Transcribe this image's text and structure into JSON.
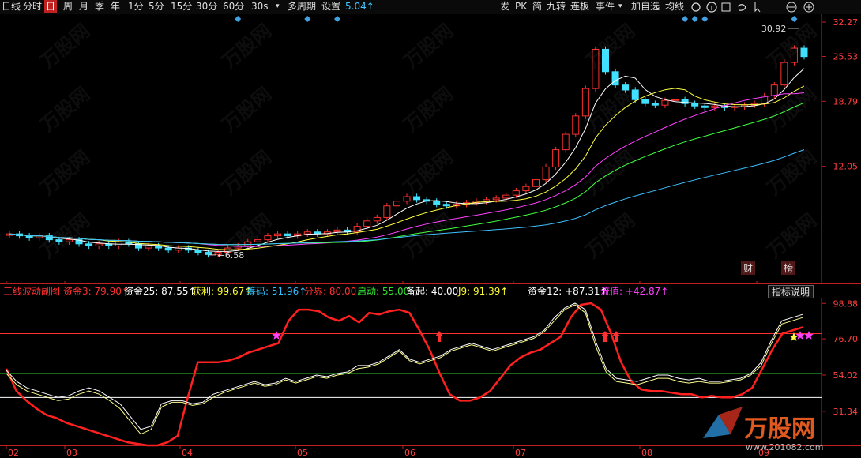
{
  "toolbar": {
    "items": [
      "日线",
      "分时",
      "日",
      "周",
      "月",
      "季",
      "年",
      "1分",
      "5分",
      "15分",
      "30分",
      "60分",
      "30s",
      "▾",
      "多周期",
      "设置"
    ],
    "active_index": 2,
    "value_label": "5.04↑",
    "right_items": [
      "发",
      "PK",
      "简",
      "九转",
      "连板",
      "事件",
      "▾",
      "加自选",
      "均线"
    ]
  },
  "indicator": {
    "name": "三线波动副图",
    "series_labels": [
      {
        "text": "资金3: 79.90↑",
        "color": "#ff3030"
      },
      {
        "text": "资金25: 87.55↑",
        "color": "#ffffff"
      },
      {
        "text": "获利: 99.67↑",
        "color": "#ffff30"
      },
      {
        "text": "筹码: 51.96↑",
        "color": "#30c0ff"
      },
      {
        "text": "分界: 80.00",
        "color": "#ff3030"
      },
      {
        "text": "启动: 55.00",
        "color": "#30e030"
      },
      {
        "text": "备起: 40.00",
        "color": "#ffffff"
      },
      {
        "text": "J9: 91.39↑",
        "color": "#ffff30"
      },
      {
        "text": "资金12: +87.31↑",
        "color": "#ffffff"
      },
      {
        "text": "流值: +42.87↑",
        "color": "#ff40ff"
      }
    ],
    "help_button": "指标说明"
  },
  "annotations": {
    "high": "30.92",
    "low": "6.58",
    "badge1": "财",
    "badge2": "榜"
  },
  "watermark": {
    "text": "万股网",
    "url": "www.201082.com"
  },
  "colors": {
    "up": "#ff3030",
    "down": "#40e0ff",
    "bg": "#000000",
    "axis": "#c02020",
    "ma5": "#ffffff",
    "ma10": "#ffff40",
    "ma20": "#ff40ff",
    "ma30": "#40ff40",
    "ma60": "#40c0ff"
  },
  "chart_data": [
    {
      "type": "candlestick",
      "title": "",
      "x_ticks": [
        "02",
        "03",
        "04",
        "05",
        "06",
        "07",
        "08",
        "09"
      ],
      "y_ticks": [
        32.27,
        25.53,
        18.79,
        12.05
      ],
      "ylim": [
        6.0,
        32.27
      ],
      "closes": [
        7.6,
        7.5,
        7.4,
        7.5,
        7.3,
        7.2,
        7.3,
        7.1,
        7.0,
        7.1,
        7.0,
        7.2,
        7.1,
        6.9,
        7.0,
        6.9,
        6.8,
        6.9,
        6.8,
        6.7,
        6.6,
        6.7,
        6.9,
        7.0,
        7.2,
        7.3,
        7.5,
        7.6,
        7.5,
        7.6,
        7.7,
        7.6,
        7.7,
        7.8,
        7.7,
        8.0,
        8.3,
        8.5,
        9.2,
        9.5,
        9.8,
        9.6,
        9.5,
        9.3,
        9.2,
        9.3,
        9.4,
        9.5,
        9.6,
        9.7,
        9.9,
        10.2,
        10.5,
        11.0,
        12.0,
        13.5,
        15.0,
        17.0,
        20.5,
        26.8,
        23.0,
        21.0,
        20.3,
        19.0,
        18.5,
        18.3,
        18.9,
        19.0,
        18.5,
        18.2,
        18.0,
        18.2,
        18.0,
        18.1,
        18.3,
        18.5,
        19.5,
        21.0,
        24.5,
        27.0,
        25.5
      ],
      "series": [
        {
          "name": "",
          "color": "#ffffff"
        },
        {
          "name": "",
          "color": "#ffff40"
        },
        {
          "name": "",
          "color": "#ff40ff"
        },
        {
          "name": "",
          "color": "#40ff40"
        },
        {
          "name": "",
          "color": "#40c0ff"
        }
      ]
    },
    {
      "type": "line",
      "title": "三线波动副图",
      "y_ticks": [
        98.88,
        76.7,
        54.02,
        31.34
      ],
      "ylim": [
        10,
        100
      ],
      "reference_lines": [
        {
          "name": "分界",
          "value": 80
        },
        {
          "name": "启动",
          "value": 55
        },
        {
          "name": "备起",
          "value": 40
        }
      ],
      "series": [
        {
          "name": "资金3",
          "color": "#ff2020",
          "values": [
            58,
            44,
            38,
            33,
            29,
            27,
            24,
            22,
            20,
            18,
            16,
            14,
            12,
            11,
            10,
            10,
            12,
            16,
            40,
            62,
            62,
            62,
            63,
            65,
            68,
            70,
            72,
            74,
            88,
            95,
            95,
            94,
            90,
            88,
            91,
            87,
            93,
            92,
            94,
            95,
            93,
            82,
            70,
            55,
            42,
            38,
            38,
            40,
            44,
            52,
            60,
            65,
            68,
            70,
            74,
            78,
            90,
            98,
            99,
            95,
            80,
            62,
            50,
            45,
            44,
            44,
            43,
            42,
            42,
            40,
            41,
            40,
            40,
            42,
            46,
            58,
            70,
            80,
            82,
            84
          ]
        },
        {
          "name": "资金25",
          "color": "#ffffff",
          "values": [
            57,
            50,
            46,
            44,
            42,
            40,
            41,
            44,
            46,
            44,
            40,
            36,
            28,
            20,
            22,
            36,
            38,
            38,
            36,
            37,
            42,
            44,
            46,
            48,
            50,
            48,
            49,
            52,
            50,
            52,
            54,
            53,
            55,
            56,
            60,
            60,
            62,
            66,
            70,
            64,
            62,
            64,
            66,
            70,
            72,
            74,
            72,
            70,
            72,
            74,
            76,
            78,
            82,
            90,
            96,
            99,
            95,
            75,
            58,
            52,
            51,
            50,
            52,
            54,
            54,
            52,
            51,
            52,
            50,
            50,
            51,
            52,
            55,
            62,
            76,
            88,
            90,
            92
          ]
        },
        {
          "name": "资金12",
          "color": "#ffff90",
          "values": [
            55,
            48,
            44,
            42,
            40,
            38,
            39,
            42,
            44,
            42,
            38,
            33,
            25,
            17,
            20,
            34,
            37,
            37,
            35,
            36,
            40,
            43,
            45,
            47,
            49,
            47,
            48,
            51,
            49,
            51,
            53,
            52,
            54,
            55,
            58,
            59,
            61,
            65,
            69,
            63,
            61,
            63,
            65,
            69,
            71,
            73,
            71,
            69,
            71,
            73,
            75,
            77,
            81,
            88,
            95,
            98,
            93,
            72,
            56,
            50,
            49,
            48,
            50,
            52,
            52,
            50,
            49,
            50,
            49,
            49,
            50,
            51,
            54,
            60,
            74,
            86,
            88,
            90
          ]
        }
      ]
    }
  ]
}
